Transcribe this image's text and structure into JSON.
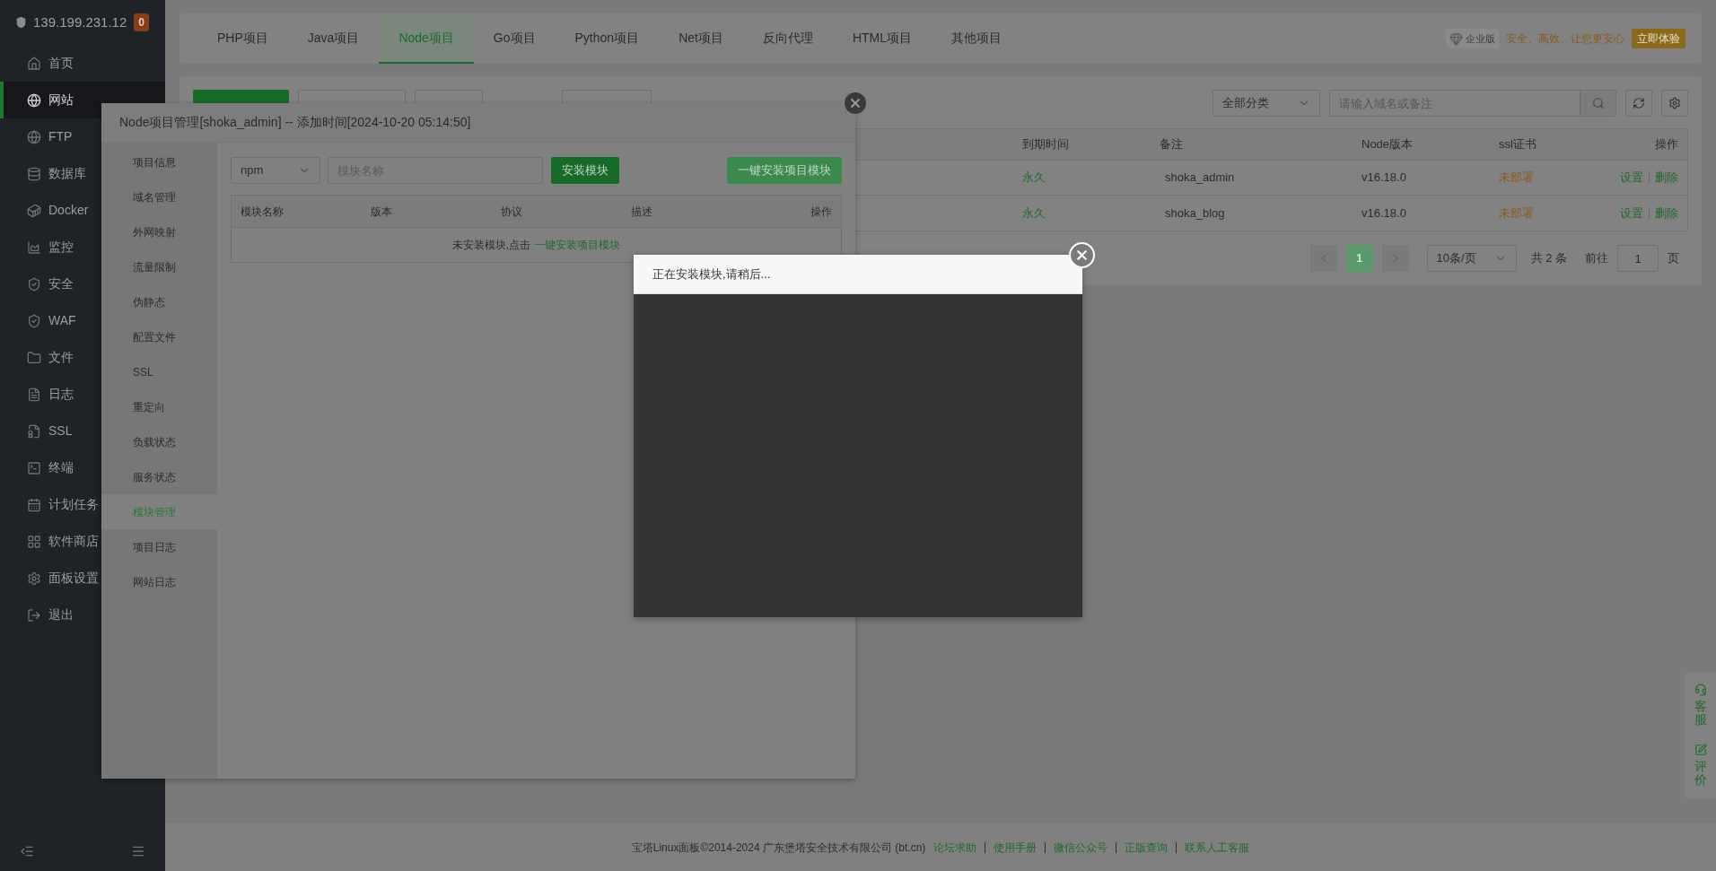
{
  "sidebar": {
    "host": "139.199.231.12",
    "badge": "0",
    "items": [
      {
        "label": "首页",
        "kind": "home",
        "selected": false
      },
      {
        "label": "网站",
        "kind": "globe",
        "selected": true
      },
      {
        "label": "FTP",
        "kind": "globe",
        "selected": false
      },
      {
        "label": "数据库",
        "kind": "database",
        "selected": false
      },
      {
        "label": "Docker",
        "kind": "container",
        "selected": false
      },
      {
        "label": "监控",
        "kind": "chart",
        "selected": false
      },
      {
        "label": "安全",
        "kind": "shield",
        "selected": false
      },
      {
        "label": "WAF",
        "kind": "shield",
        "selected": false
      },
      {
        "label": "文件",
        "kind": "folder",
        "selected": false
      },
      {
        "label": "日志",
        "kind": "file",
        "selected": false
      },
      {
        "label": "SSL",
        "kind": "cert",
        "selected": false
      },
      {
        "label": "终端",
        "kind": "terminal",
        "selected": false
      },
      {
        "label": "计划任务",
        "kind": "calendar",
        "selected": false
      },
      {
        "label": "软件商店",
        "kind": "grid",
        "selected": false
      },
      {
        "label": "面板设置",
        "kind": "gear",
        "selected": false
      },
      {
        "label": "退出",
        "kind": "logout",
        "selected": false
      }
    ]
  },
  "top_tabs": [
    {
      "label": "PHP项目",
      "selected": false
    },
    {
      "label": "Java项目",
      "selected": false
    },
    {
      "label": "Node项目",
      "selected": true
    },
    {
      "label": "Go项目",
      "selected": false
    },
    {
      "label": "Python项目",
      "selected": false
    },
    {
      "label": "Net项目",
      "selected": false
    },
    {
      "label": "反向代理",
      "selected": false
    },
    {
      "label": "HTML项目",
      "selected": false
    },
    {
      "label": "其他项目",
      "selected": false
    }
  ],
  "promo": {
    "edition": "企业版",
    "slogan": "安全、高效、让您更安心",
    "button": "立即体验"
  },
  "toolbar": {
    "category": "全部分类",
    "search_placeholder": "请输入域名或备注"
  },
  "sites_table": {
    "columns": [
      "到期时间",
      "备注",
      "Node版本",
      "ssl证书",
      "操作"
    ],
    "rows": [
      {
        "expiry": "永久",
        "note": "shoka_admin",
        "version": "v16.18.0",
        "ssl": "未部署",
        "actions": [
          "设置",
          "删除"
        ]
      },
      {
        "expiry": "永久",
        "note": "shoka_blog",
        "version": "v16.18.0",
        "ssl": "未部署",
        "actions": [
          "设置",
          "删除"
        ]
      }
    ]
  },
  "pagination": {
    "pages": [
      {
        "label": "1",
        "selected": true
      }
    ],
    "page_size": "10条/页",
    "total": "共 2 条",
    "goto_label": "前往",
    "goto_value": "1",
    "unit": "页"
  },
  "project_dialog": {
    "title": "Node项目管理[shoka_admin] -- 添加时间[2024-10-20 05:14:50]",
    "nav": [
      {
        "label": "项目信息",
        "selected": false
      },
      {
        "label": "域名管理",
        "selected": false
      },
      {
        "label": "外网映射",
        "selected": false
      },
      {
        "label": "流量限制",
        "selected": false
      },
      {
        "label": "伪静态",
        "selected": false
      },
      {
        "label": "配置文件",
        "selected": false
      },
      {
        "label": "SSL",
        "selected": false
      },
      {
        "label": "重定向",
        "selected": false
      },
      {
        "label": "负载状态",
        "selected": false
      },
      {
        "label": "服务状态",
        "selected": false
      },
      {
        "label": "模块管理",
        "selected": true
      },
      {
        "label": "项目日志",
        "selected": false
      },
      {
        "label": "网站日志",
        "selected": false
      }
    ],
    "manager": "npm",
    "module_placeholder": "模块名称",
    "install_button": "安装模块",
    "install_all_button": "一键安装项目模块",
    "columns": [
      "模块名称",
      "版本",
      "协议",
      "描述",
      "操作"
    ],
    "empty_text": "未安装模块,点击",
    "empty_link": "一键安装项目模块"
  },
  "progress_dialog": {
    "title": "正在安装模块,请稍后..."
  },
  "float_panel": [
    {
      "label": "客服",
      "kind": "headset"
    },
    {
      "label": "评价",
      "kind": "edit"
    }
  ],
  "footer": {
    "copyright": "宝塔Linux面板©2014-2024 广东堡塔安全技术有限公司 (bt.cn)",
    "links": [
      "论坛求助",
      "使用手册",
      "微信公众号",
      "正版查询",
      "联系人工客服"
    ]
  }
}
